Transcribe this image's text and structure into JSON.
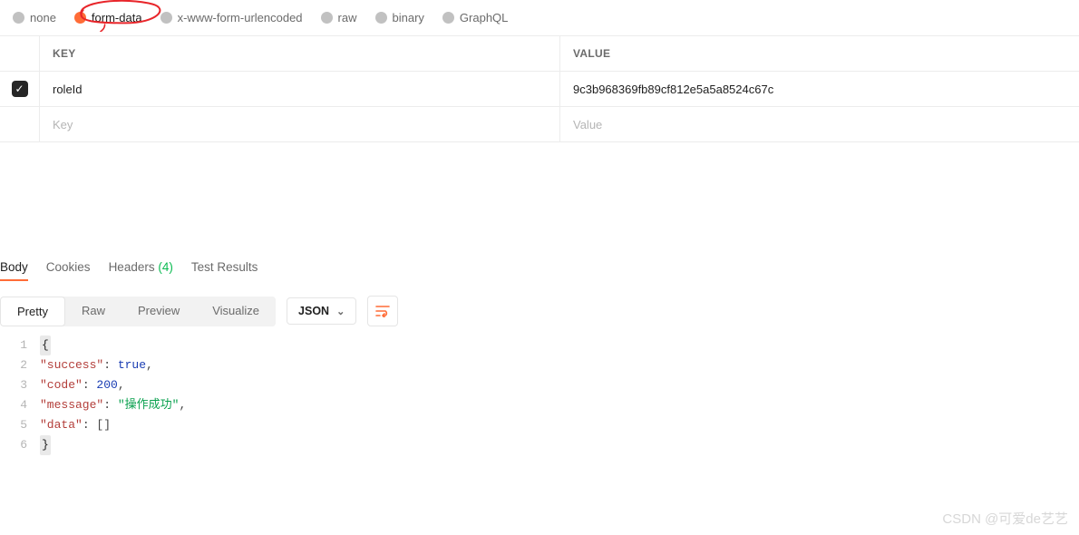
{
  "body_types": {
    "options": [
      {
        "id": "none",
        "label": "none"
      },
      {
        "id": "form-data",
        "label": "form-data"
      },
      {
        "id": "x-www-form-urlencoded",
        "label": "x-www-form-urlencoded"
      },
      {
        "id": "raw",
        "label": "raw"
      },
      {
        "id": "binary",
        "label": "binary"
      },
      {
        "id": "graphql",
        "label": "GraphQL"
      }
    ],
    "selected": "form-data"
  },
  "kv_table": {
    "headers": {
      "key": "KEY",
      "value": "VALUE"
    },
    "rows": [
      {
        "checked": true,
        "key": "roleId",
        "value": "9c3b968369fb89cf812e5a5a8524c67c"
      }
    ],
    "placeholder": {
      "key": "Key",
      "value": "Value"
    }
  },
  "response": {
    "tabs": {
      "body": "Body",
      "cookies": "Cookies",
      "headers": "Headers",
      "headers_count": "(4)",
      "test_results": "Test Results",
      "active": "body"
    },
    "view_modes": {
      "pretty": "Pretty",
      "raw": "Raw",
      "preview": "Preview",
      "visualize": "Visualize",
      "active": "pretty"
    },
    "format_dd": "JSON",
    "json_display": {
      "success_key": "\"success\"",
      "success_val": "true",
      "code_key": "\"code\"",
      "code_val": "200",
      "message_key": "\"message\"",
      "message_val": "\"操作成功\"",
      "data_key": "\"data\"",
      "data_val": "[]",
      "brace_open": "{",
      "brace_close": "}"
    },
    "line_numbers": [
      "1",
      "2",
      "3",
      "4",
      "5",
      "6"
    ]
  },
  "colors": {
    "accent": "#ff6c37",
    "success": "#0cbb52"
  },
  "watermark": "CSDN @可爱de艺艺"
}
